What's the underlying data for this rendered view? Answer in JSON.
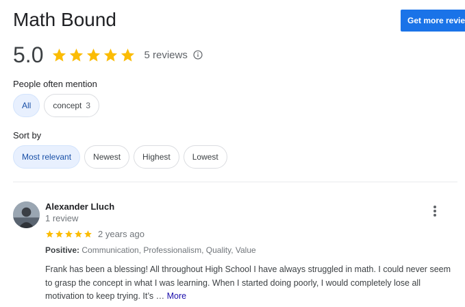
{
  "place": {
    "title": "Math Bound",
    "get_more_label": "Get more reviews"
  },
  "summary": {
    "rating": "5.0",
    "review_count_text": "5 reviews",
    "star_color": "#fbbc04"
  },
  "mentions": {
    "label": "People often mention",
    "chips": [
      {
        "label": "All",
        "count": ""
      },
      {
        "label": "concept",
        "count": "3"
      }
    ]
  },
  "sort": {
    "label": "Sort by",
    "options": [
      "Most relevant",
      "Newest",
      "Highest",
      "Lowest"
    ]
  },
  "review": {
    "author": "Alexander Lluch",
    "author_meta": "1 review",
    "time": "2 years ago",
    "positive_label": "Positive:",
    "positive_values": "Communication, Professionalism, Quality, Value",
    "text": "Frank has been a blessing! All throughout High School I have always struggled in math. I could never seem to grasp the concept in what I was learning. When I started doing poorly, I would completely lose all motivation to keep trying. It’s …",
    "more_label": "More"
  }
}
